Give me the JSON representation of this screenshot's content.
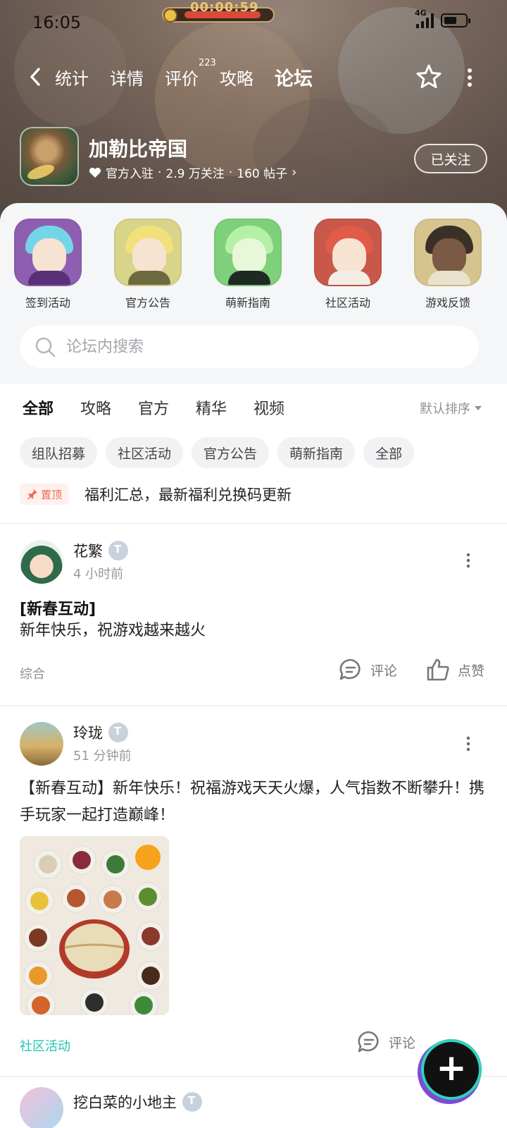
{
  "status_bar": {
    "time": "16:05",
    "network": "4G",
    "battery_level": 0.6
  },
  "game_hud": {
    "timer": "00:00:59"
  },
  "nav": {
    "tabs": [
      {
        "label": "统计"
      },
      {
        "label": "详情"
      },
      {
        "label": "评价",
        "badge": "223"
      },
      {
        "label": "攻略"
      },
      {
        "label": "论坛",
        "active": true
      }
    ]
  },
  "game": {
    "title": "加勒比帝国",
    "official": "官方入驻",
    "followers": "2.9 万关注",
    "posts": "160 帖子",
    "follow_button": "已关注"
  },
  "shortcuts": [
    {
      "label": "签到活动"
    },
    {
      "label": "官方公告"
    },
    {
      "label": "萌新指南"
    },
    {
      "label": "社区活动"
    },
    {
      "label": "游戏反馈"
    }
  ],
  "search": {
    "placeholder": "论坛内搜索"
  },
  "filter_tabs": [
    {
      "label": "全部",
      "active": true
    },
    {
      "label": "攻略"
    },
    {
      "label": "官方"
    },
    {
      "label": "精华"
    },
    {
      "label": "视频"
    }
  ],
  "sort_label": "默认排序",
  "chips": [
    "组队招募",
    "社区活动",
    "官方公告",
    "萌新指南",
    "全部"
  ],
  "pinned": {
    "badge": "置顶",
    "text": "福利汇总，最新福利兑换码更新"
  },
  "posts": [
    {
      "user": "花繁",
      "time": "4 小时前",
      "title": "[新春互动]",
      "body": "新年快乐，祝游戏越来越火",
      "tag": "综合",
      "comment_label": "评论",
      "like_label": "点赞"
    },
    {
      "user": "玲珑",
      "time": "51 分钟前",
      "body": "【新春互动】新年快乐！祝福游戏天天火爆，人气指数不断攀升！携手玩家一起打造巅峰！",
      "tag": "社区活动",
      "comment_label": "评论"
    },
    {
      "user": "挖白菜的小地主"
    }
  ],
  "colors": {
    "accent": "#2fd3c0",
    "pin": "#f06a52",
    "tag_teal": "#20c5b5"
  }
}
